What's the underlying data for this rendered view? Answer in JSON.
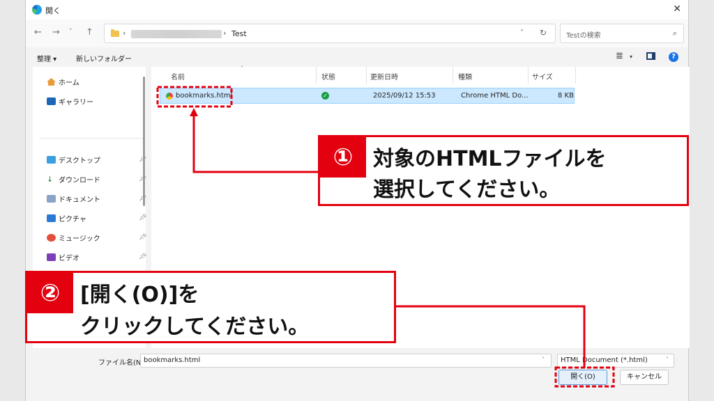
{
  "window": {
    "title": "開く"
  },
  "address": {
    "current_folder": "Test"
  },
  "search": {
    "placeholder": "Testの検索"
  },
  "toolbar": {
    "organize": "整理",
    "new_folder": "新しいフォルダー"
  },
  "sidebar": {
    "items": [
      {
        "label": "ホーム",
        "icon": "home-icon"
      },
      {
        "label": "ギャラリー",
        "icon": "gallery-icon"
      },
      {
        "label": "デスクトップ",
        "icon": "desktop-icon"
      },
      {
        "label": "ダウンロード",
        "icon": "download-icon"
      },
      {
        "label": "ドキュメント",
        "icon": "document-icon"
      },
      {
        "label": "ピクチャ",
        "icon": "pictures-icon"
      },
      {
        "label": "ミュージック",
        "icon": "music-icon"
      },
      {
        "label": "ビデオ",
        "icon": "video-icon"
      }
    ]
  },
  "columns": {
    "name": "名前",
    "status": "状態",
    "date": "更新日時",
    "type": "種類",
    "size": "サイズ"
  },
  "files": [
    {
      "name": "bookmarks.html",
      "status": "synced",
      "date": "2025/09/12 15:53",
      "type": "Chrome HTML Do...",
      "size": "8 KB"
    }
  ],
  "bottom": {
    "filename_label": "ファイル名(N):",
    "filename_value": "bookmarks.html",
    "filter_value": "HTML Document (*.html)",
    "open_button": "開く(O)",
    "cancel_button": "キャンセル"
  },
  "annotations": {
    "step1": {
      "number": "①",
      "line1": "対象のHTMLファイルを",
      "line2": "選択してください。"
    },
    "step2": {
      "number": "②",
      "line1": "[開く(O)]を",
      "line2": "クリックしてください。"
    }
  },
  "colors": {
    "accent": "#e3000f",
    "selection": "#cce8ff"
  }
}
